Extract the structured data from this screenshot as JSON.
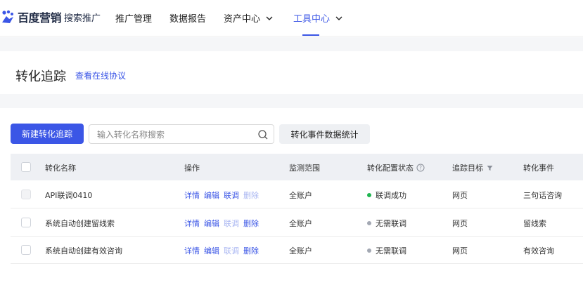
{
  "nav": {
    "brand": "百度营销",
    "brand_sub": "搜索推广",
    "items": [
      {
        "label": "推广管理",
        "dropdown": false,
        "active": false
      },
      {
        "label": "数据报告",
        "dropdown": false,
        "active": false
      },
      {
        "label": "资产中心",
        "dropdown": true,
        "active": false
      },
      {
        "label": "工具中心",
        "dropdown": true,
        "active": true
      }
    ]
  },
  "header": {
    "title": "转化追踪",
    "link": "查看在线协议"
  },
  "toolbar": {
    "new_button": "新建转化追踪",
    "search_placeholder": "输入转化名称搜索",
    "stats_button": "转化事件数据统计"
  },
  "table": {
    "columns": [
      "转化名称",
      "操作",
      "监测范围",
      "转化配置状态",
      "追踪目标",
      "转化事件"
    ],
    "action_labels": [
      "详情",
      "编辑",
      "联调",
      "删除"
    ],
    "rows": [
      {
        "name": "API联调0410",
        "actions_enabled": [
          true,
          true,
          true,
          false
        ],
        "scope": "全账户",
        "status": "联调成功",
        "status_color": "#1fb550",
        "target": "网页",
        "event": "三句话咨询",
        "selectable": false
      },
      {
        "name": "系统自动创建留线索",
        "actions_enabled": [
          true,
          true,
          false,
          true
        ],
        "scope": "全账户",
        "status": "无需联调",
        "status_color": "#a3a8b3",
        "target": "网页",
        "event": "留线索",
        "selectable": true
      },
      {
        "name": "系统自动创建有效咨询",
        "actions_enabled": [
          true,
          true,
          false,
          true
        ],
        "scope": "全账户",
        "status": "无需联调",
        "status_color": "#a3a8b3",
        "target": "网页",
        "event": "有效咨询",
        "selectable": true
      }
    ]
  },
  "colors": {
    "accent": "#3b56e6",
    "header_bg": "#eef0f4"
  }
}
